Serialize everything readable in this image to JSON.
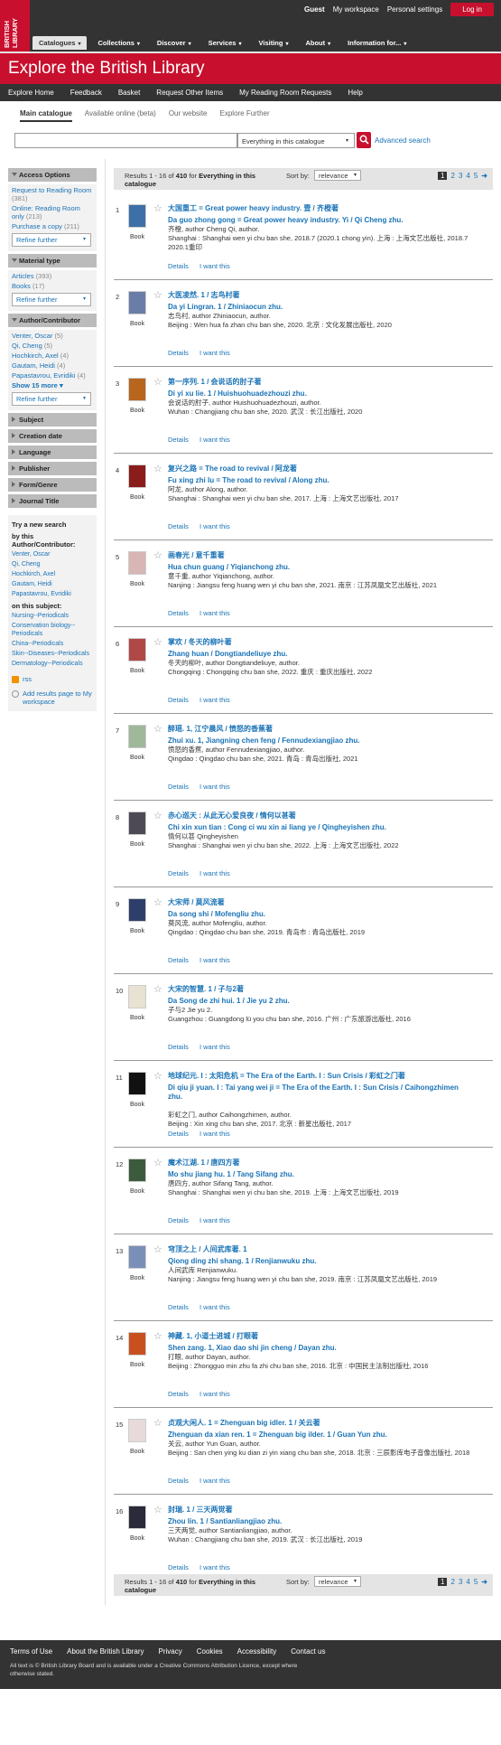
{
  "logo": {
    "text": "BRITISH LIBRARY"
  },
  "top": {
    "guest": "Guest",
    "workspace": "My workspace",
    "personal": "Personal settings",
    "login": "Log in"
  },
  "mainnav": [
    "Catalogues",
    "Collections",
    "Discover",
    "Services",
    "Visiting",
    "About",
    "Information for..."
  ],
  "banner": {
    "title": "Explore the British Library"
  },
  "subnav": [
    "Explore Home",
    "Feedback",
    "Basket",
    "Request Other Items",
    "My Reading Room Requests",
    "Help"
  ],
  "scope_tabs": [
    "Main catalogue",
    "Available online (beta)",
    "Our website",
    "Explore Further"
  ],
  "search": {
    "value": "",
    "scope": "Everything in this catalogue",
    "advanced": "Advanced search"
  },
  "sidebar": {
    "access": {
      "title": "Access Options",
      "items": [
        {
          "label": "Request to Reading Room",
          "count": "(381)"
        },
        {
          "label": "Online: Reading Room only",
          "count": "(213)"
        },
        {
          "label": "Purchase a copy",
          "count": "(211)"
        }
      ],
      "refine": "Refine further"
    },
    "material": {
      "title": "Material type",
      "items": [
        {
          "label": "Articles",
          "count": "(393)"
        },
        {
          "label": "Books",
          "count": "(17)"
        }
      ],
      "refine": "Refine further"
    },
    "author": {
      "title": "Author/Contributor",
      "items": [
        {
          "label": "Venter, Oscar",
          "count": "(5)"
        },
        {
          "label": "Qi, Cheng",
          "count": "(5)"
        },
        {
          "label": "Hochkirch, Axel",
          "count": "(4)"
        },
        {
          "label": "Gautam, Heidi",
          "count": "(4)"
        },
        {
          "label": "Papastavrou, Evridiki",
          "count": "(4)"
        }
      ],
      "show_more": "Show 15 more",
      "refine": "Refine further"
    },
    "collapsed": [
      "Subject",
      "Creation date",
      "Language",
      "Publisher",
      "Form/Genre",
      "Journal Title"
    ],
    "trynew": {
      "title": "Try a new search",
      "by_author": "by this Author/Contributor:",
      "authors": [
        "Venter, Oscar",
        "Qi, Cheng",
        "Hochkirch, Axel",
        "Gautam, Heidi",
        "Papastavrou, Evridiki"
      ],
      "on_subject": "on this subject:",
      "subjects": [
        "Nursing--Periodicals",
        "Conservation biology--Periodicals",
        "China--Periodicals",
        "Skin--Diseases--Periodicals",
        "Dermatology--Periodicals"
      ]
    },
    "rss": "rss",
    "add_ws": "Add results page to My workspace"
  },
  "results_bar": {
    "range": "Results 1 - 16 of",
    "total": "410",
    "for": "for",
    "scope": "Everything in this catalogue",
    "sort_label": "Sort by:",
    "sort": "relevance",
    "pages": [
      "1",
      "2",
      "3",
      "4",
      "5"
    ]
  },
  "results_footer": {
    "range": "Results 1 - 16 of",
    "total": "410",
    "for": "for",
    "scope": "Everything in this catalogue",
    "sort_label": "Sort by:",
    "sort": "relevance",
    "pages": [
      "1",
      "2",
      "3",
      "4",
      "5"
    ]
  },
  "records": [
    {
      "n": "1",
      "type": "Book",
      "title": "大国重工 = Great power heavy industry. 壹 / 齐橙著",
      "rom": "Da guo zhong gong = Great power heavy industry. Yi / Qi Cheng zhu.",
      "pub": [
        "齐橙, author Cheng Qi, author.",
        "Shanghai : Shanghai wen yi chu ban she, 2018.7 (2020.1 chong yin). 上海 : 上海文艺出版社, 2018.7 2020.1重印"
      ],
      "details": "Details",
      "want": "I want this",
      "color": "#3d6fa8"
    },
    {
      "n": "2",
      "type": "Book",
      "title": "大医凌然. 1 / 志鸟村著",
      "rom": "Da yi Lingran. 1 / Zhiniaocun zhu.",
      "pub": [
        "志鸟村, author Zhiniaocun, author.",
        "Beijing : Wen hua fa zhan chu ban she, 2020. 北京 : 文化发展出版社, 2020"
      ],
      "details": "Details",
      "want": "I want this",
      "color": "#6a7ca8"
    },
    {
      "n": "3",
      "type": "Book",
      "title": "第一序列. 1 / 会说话的肘子著",
      "rom": "Di yi xu lie. 1 / Huishuohuadezhouzi zhu.",
      "pub": [
        "会说话的肘子, author Huishuohuadezhouzi, author.",
        "Wuhan : Changjiang chu ban she, 2020. 武汉 : 长江出版社, 2020"
      ],
      "details": "Details",
      "want": "I want this",
      "color": "#b8651e"
    },
    {
      "n": "4",
      "type": "Book",
      "title": "复兴之路 = The road to revival / 阿龙著",
      "rom": "Fu xing zhi lu = The road to revival / Along zhu.",
      "pub": [
        "阿龙, author Along, author.",
        "Shanghai : Shanghai wen yi chu ban she, 2017. 上海 : 上海文艺出版社, 2017"
      ],
      "details": "Details",
      "want": "I want this",
      "color": "#8a1c1c"
    },
    {
      "n": "5",
      "type": "Book",
      "title": "画春光 / 意千重著",
      "rom": "Hua chun guang / Yiqianchong zhu.",
      "pub": [
        "意千重, author Yiqianchong, author.",
        "Nanjing : Jiangsu feng huang wen yi chu ban she, 2021. 南京 : 江苏凤凰文艺出版社, 2021"
      ],
      "details": "Details",
      "want": "I want this",
      "color": "#d8b6b6"
    },
    {
      "n": "6",
      "type": "Book",
      "title": "掌欢 / 冬天的柳叶著",
      "rom": "Zhang huan / Dongtiandeliuye zhu.",
      "pub": [
        "冬天的柳叶, author Dongtiandeliuye, author.",
        "Chongqing : Chongqing chu ban she, 2022. 重庆 : 重庆出版社, 2022"
      ],
      "details": "Details",
      "want": "I want this",
      "color": "#b04848"
    },
    {
      "n": "7",
      "type": "Book",
      "title": "醉瑶. 1, 江宁晨风 / 愤怒的香蕉著",
      "rom": "Zhui xu. 1, Jiangning chen feng / Fennudexiangjiao zhu.",
      "pub": [
        "愤怒的香蕉, author Fennudexiangjiao, author.",
        "Qingdao : Qingdao chu ban she, 2021. 青岛 : 青岛出版社, 2021"
      ],
      "details": "Details",
      "want": "I want this",
      "color": "#9fb89a"
    },
    {
      "n": "8",
      "type": "Book",
      "title": "赤心巡天 : 从此无心爱良夜 / 情何以甚著",
      "rom": "Chi xin xun tian : Cong ci wu xin ai liang ye / Qingheyishen zhu.",
      "pub": [
        "情何以甚 Qingheyishen",
        "Shanghai : Shanghai wen yi chu ban she, 2022. 上海 : 上海文艺出版社, 2022"
      ],
      "details": "Details",
      "want": "I want this",
      "color": "#4e4a55"
    },
    {
      "n": "9",
      "type": "Book",
      "title": "大宋师 / 莫风流著",
      "rom": "Da song shi / Mofengliu zhu.",
      "pub": [
        "莫风流, author Mofengliu, author.",
        "Qingdao : Qingdao chu ban she, 2019. 青岛市 : 青岛出版社, 2019"
      ],
      "details": "Details",
      "want": "I want this",
      "color": "#2e3e6a"
    },
    {
      "n": "10",
      "type": "Book",
      "title": "大宋的智慧. 1 / 子与2著",
      "rom": "Da Song de zhi hui. 1 / Jie yu 2 zhu.",
      "pub": [
        "子与2 Jie yu 2.",
        "Guangzhou : Guangdong lü you chu ban she, 2016. 广州 : 广东旅游出版社, 2016"
      ],
      "details": "Details",
      "want": "I want this",
      "color": "#e8e2d2"
    },
    {
      "n": "11",
      "type": "Book",
      "title": "地球纪元. I : 太阳危机 = The Era of the Earth. I : Sun Crisis / 彩虹之门著",
      "rom": "Di qiu ji yuan. I : Tai yang wei ji = The Era of the Earth. I : Sun Crisis / Caihongzhimen zhu.",
      "pub": [
        "彩虹之门, author Caihongzhimen, author.",
        "Beijing : Xin xing chu ban she, 2017. 北京 : 新星出版社, 2017"
      ],
      "details": "Details",
      "want": "I want this",
      "color": "#111111"
    },
    {
      "n": "12",
      "type": "Book",
      "title": "魔术江湖. 1 / 唐四方著",
      "rom": "Mo shu jiang hu. 1 / Tang Sifang zhu.",
      "pub": [
        "唐四方, author Sifang Tang, author.",
        "Shanghai : Shanghai wen yi chu ban she, 2019. 上海 : 上海文艺出版社, 2019"
      ],
      "details": "Details",
      "want": "I want this",
      "color": "#3c5a3c"
    },
    {
      "n": "13",
      "type": "Book",
      "title": "穹顶之上 / 人间武库著. 1",
      "rom": "Qiong ding zhi shang. 1 / Renjianwuku zhu.",
      "pub": [
        "人间武库 Renjianwuku.",
        "Nanjing : Jiangsu feng huang wen yi chu ban she, 2019. 南京 : 江苏凤凰文艺出版社, 2019"
      ],
      "details": "Details",
      "want": "I want this",
      "color": "#7a8fb8"
    },
    {
      "n": "14",
      "type": "Book",
      "title": "神藏. 1, 小道士进城 / 打眼著",
      "rom": "Shen zang. 1, Xiao dao shi jin cheng / Dayan zhu.",
      "pub": [
        "打眼, author Dayan, author.",
        "Beijing : Zhongguo min zhu fa zhi chu ban she, 2016. 北京 : 中国民主法制出版社, 2016"
      ],
      "details": "Details",
      "want": "I want this",
      "color": "#c8501e"
    },
    {
      "n": "15",
      "type": "Book",
      "title": "贞观大闲人. 1 = Zhenguan big idler. 1 / 关云著",
      "rom": "Zhenguan da xian ren. 1 = Zhenguan big ilder. 1 / Guan Yun zhu.",
      "pub": [
        "关云, author Yun Guan, author.",
        "Beijing : San chen ying ku dian zi yin xiang chu ban she, 2018. 北京 : 三辰影库电子音像出版社, 2018"
      ],
      "details": "Details",
      "want": "I want this",
      "color": "#e8dada"
    },
    {
      "n": "16",
      "type": "Book",
      "title": "封瑞. 1 / 三天两觉著",
      "rom": "Zhou lin. 1 / Santianliangjiao zhu.",
      "pub": [
        "三天两觉, author Santianliangjiao, author.",
        "Wuhan : Changjiang chu ban she, 2019. 武汉 : 长江出版社, 2019"
      ],
      "details": "Details",
      "want": "I want this",
      "color": "#2a2a3a"
    }
  ],
  "footer": {
    "links": [
      "Terms of Use",
      "About the British Library",
      "Privacy",
      "Cookies",
      "Accessibility",
      "Contact us"
    ],
    "copyright": "All text is © British Library Board and is available under a Creative Commons Attribution Licence, except where otherwise stated."
  }
}
